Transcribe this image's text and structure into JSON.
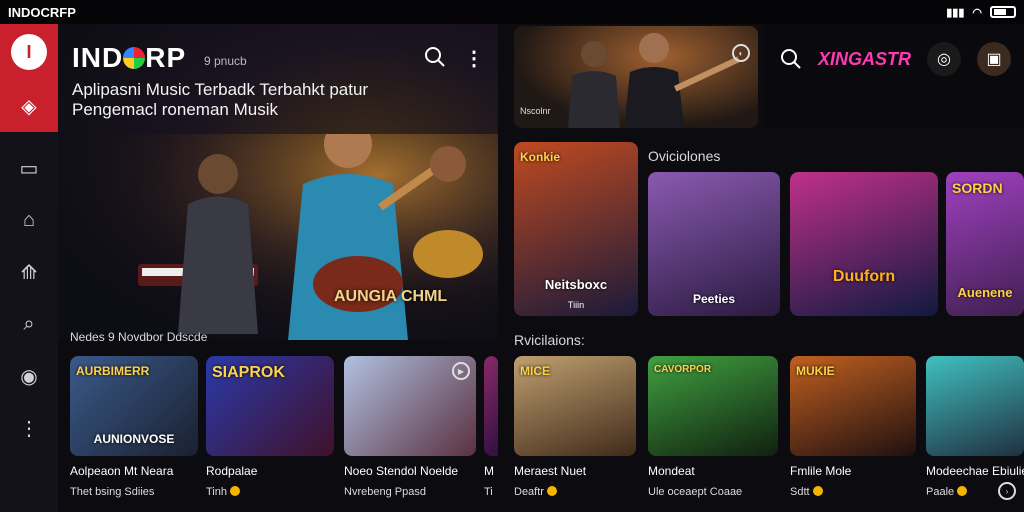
{
  "status": {
    "app_name": "INDOCRFP"
  },
  "sidebar": {
    "logo_letter": "I",
    "items": [
      {
        "name": "home",
        "glyph": "◈"
      },
      {
        "name": "library",
        "glyph": "▭"
      },
      {
        "name": "radio",
        "glyph": "⌂"
      },
      {
        "name": "explore",
        "glyph": "⟰"
      },
      {
        "name": "search",
        "glyph": "⌕"
      },
      {
        "name": "location",
        "glyph": "◉"
      },
      {
        "name": "more",
        "glyph": "⋮"
      }
    ]
  },
  "hero": {
    "title_a": "IND",
    "title_b": "RP",
    "badge": "9 pnucb",
    "subtitle": "Aplipasni Music Terbadk Terbahkt patur Pengemacl roneman Musik",
    "art_label": "AUNGIA CHML"
  },
  "hero_section_label": "Nedes 9  Novdbor Ddscde",
  "left_cards": [
    {
      "art_text": "AURBIMERR",
      "art_text2": "AUNIONVOSE",
      "title": "Aolpeaon Mt Neara",
      "sub": "Thet bsing Sdiies",
      "colors": [
        "#3a5a8a",
        "#1a2030"
      ]
    },
    {
      "art_text": "SIAPROK",
      "art_text2": "",
      "title": "Rodpalae",
      "sub": "Tinh",
      "colors": [
        "#2a3aa8",
        "#40102a"
      ]
    },
    {
      "art_text": "",
      "art_text2": "",
      "title": "Noeo Stendol Noelde",
      "sub": "Nvrebeng Ppasd",
      "colors": [
        "#b0c0e0",
        "#5a3040"
      ]
    },
    {
      "art_text": "",
      "art_text2": "",
      "title": "M",
      "sub": "Ti",
      "colors": [
        "#8a2a6a",
        "#301040"
      ]
    }
  ],
  "top_video": {
    "label": "Nscolnr"
  },
  "topright": {
    "brand": "XINGASTR"
  },
  "featured_label": "Oviciolones",
  "featured": [
    {
      "art_text": "Konkie",
      "art_text2": "Neitsboxc",
      "caption": "Tiiin",
      "colors": [
        "#c04a20",
        "#1a1a3a"
      ]
    },
    {
      "art_text": "",
      "art_text2": "Peeties",
      "caption": "",
      "colors": [
        "#8a5ab0",
        "#2a1a40"
      ]
    },
    {
      "art_text": "",
      "art_text2": "Duuforn",
      "caption": "",
      "colors": [
        "#c0308a",
        "#101a40"
      ]
    },
    {
      "art_text": "SORDN",
      "art_text2": "Auenene",
      "caption": "",
      "colors": [
        "#a040c0",
        "#402050"
      ]
    }
  ],
  "releases_label": "Rvicilaions:",
  "releases": [
    {
      "art_text": "MICE",
      "title": "Meraest Nuet",
      "sub": "Deaftr",
      "colors": [
        "#c0a070",
        "#402a1a"
      ]
    },
    {
      "art_text": "CAVORPOR",
      "title": "Mondeat",
      "sub": "Ule oceaept Coaae",
      "colors": [
        "#40a040",
        "#102010"
      ]
    },
    {
      "art_text": "MUKIE",
      "title": "Fmlile Mole",
      "sub": "Sdtt",
      "colors": [
        "#c06020",
        "#201010"
      ]
    },
    {
      "art_text": "",
      "title": "Modeechae Ebiulie",
      "sub": "Paale",
      "colors": [
        "#40c0c0",
        "#203040"
      ]
    }
  ]
}
